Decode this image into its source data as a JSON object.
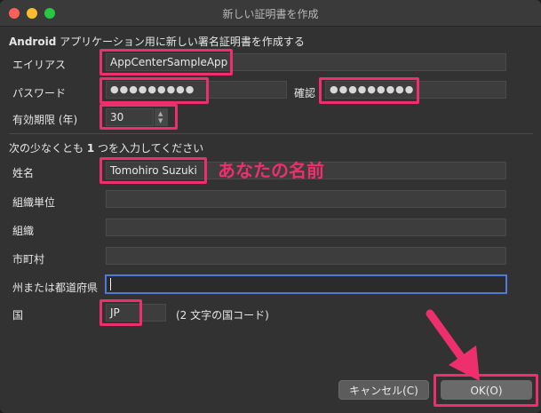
{
  "window": {
    "title": "新しい証明書を作成"
  },
  "section1": {
    "heading_bold": "Android",
    "heading_rest": " アプリケーション用に新しい署名証明書を作成する"
  },
  "alias": {
    "label": "エイリアス",
    "value": "AppCenterSampleApp"
  },
  "password": {
    "label": "パスワード",
    "value": "●●●●●●●●●",
    "confirm_label": "確認",
    "confirm_value": "●●●●●●●●●"
  },
  "validity": {
    "label": "有効期限 (年)",
    "value": "30",
    "up": "▲",
    "down": "▼"
  },
  "section2": {
    "heading_pre": "次の少なくとも ",
    "heading_num": "1",
    "heading_post": " つを入力してください"
  },
  "name": {
    "label": "姓名",
    "value": "Tomohiro Suzuki",
    "annotation": "あなたの名前"
  },
  "org_unit": {
    "label": "組織単位",
    "value": ""
  },
  "org": {
    "label": "組織",
    "value": ""
  },
  "city": {
    "label": "市町村",
    "value": ""
  },
  "state": {
    "label": "州または都道府県",
    "value": ""
  },
  "country": {
    "label": "国",
    "value": "JP",
    "hint": "(2 文字の国コード)"
  },
  "buttons": {
    "cancel": "キャンセル(C)",
    "ok": "OK(O)"
  },
  "colors": {
    "highlight": "#ee2f6d",
    "focus": "#4d7bd6",
    "background": "#323232"
  }
}
